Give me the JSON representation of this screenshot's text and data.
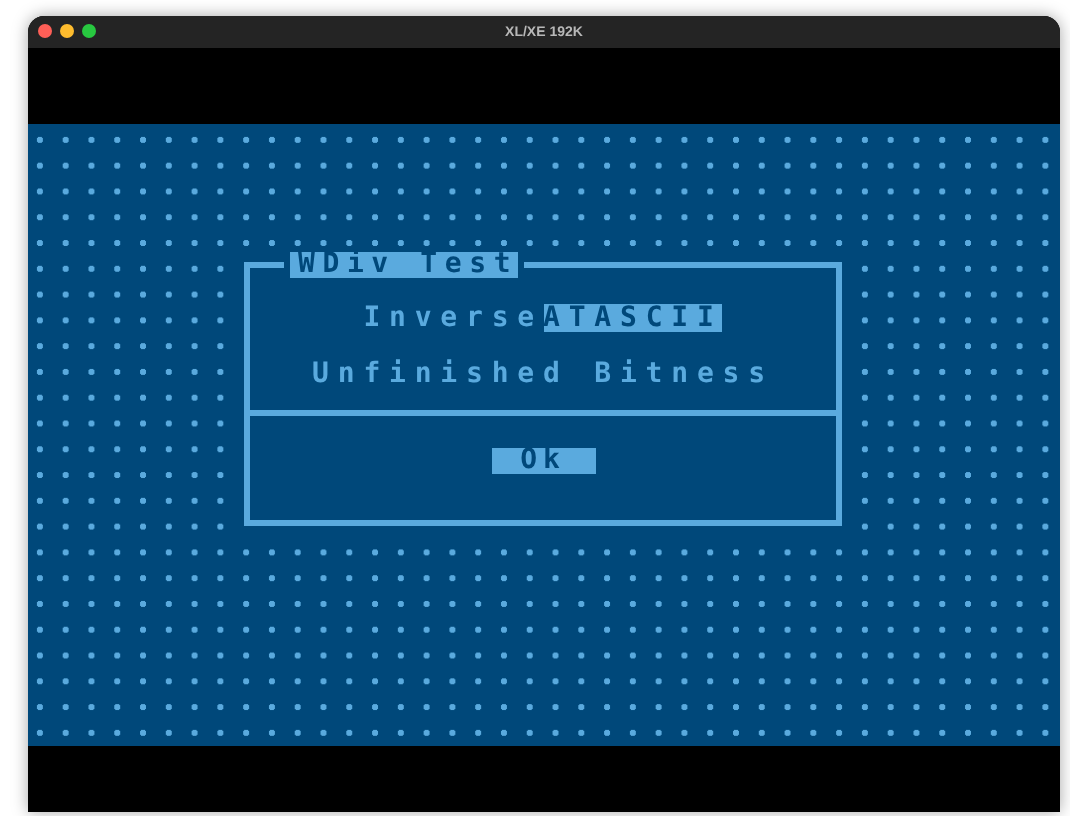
{
  "window": {
    "title": "XL/XE 192K"
  },
  "dialog": {
    "title": "WDiv Test",
    "lines": [
      {
        "segments": [
          {
            "text": "Inverse",
            "inverse": false
          },
          {
            "text": "ATASCII",
            "inverse": true
          }
        ]
      },
      {
        "segments": [
          {
            "text": "Unfinished Bitness",
            "inverse": false
          }
        ]
      }
    ],
    "button": {
      "label": "Ok"
    }
  }
}
